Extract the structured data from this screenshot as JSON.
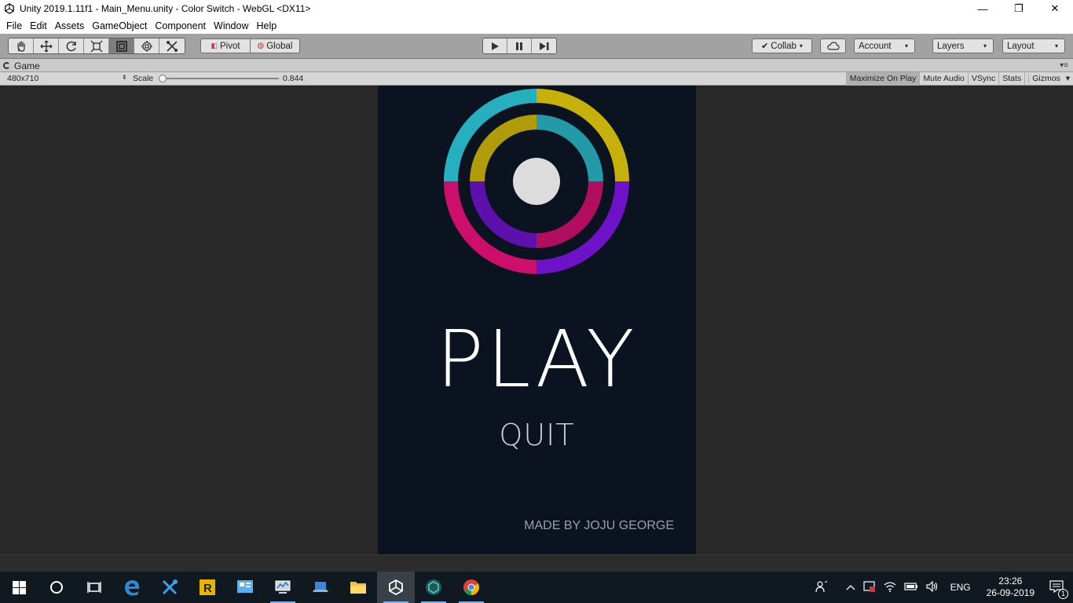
{
  "window": {
    "title": "Unity 2019.1.11f1 - Main_Menu.unity - Color Switch - WebGL <DX11>",
    "controls": [
      "—",
      "❐",
      "✕"
    ]
  },
  "menu": [
    "File",
    "Edit",
    "Assets",
    "GameObject",
    "Component",
    "Window",
    "Help"
  ],
  "toolbar": {
    "tools": [
      "hand-tool",
      "move-tool",
      "rotate-tool",
      "scale-tool",
      "rect-tool",
      "transform-tool",
      "custom-tool"
    ],
    "active_tool": "rect-tool",
    "pivot_label": "Pivot",
    "global_label": "Global",
    "collab_label": "Collab",
    "account_label": "Account",
    "layers_label": "Layers",
    "layout_label": "Layout"
  },
  "game_tab": {
    "label": "Game",
    "resolution": "480x710",
    "scale_label": "Scale",
    "scale_value": "0.844",
    "maximize_label": "Maximize On Play",
    "mute_label": "Mute Audio",
    "vsync_label": "VSync",
    "stats_label": "Stats",
    "gizmos_label": "Gizmos"
  },
  "game": {
    "play_label": "PLAY",
    "quit_label": "QUIT",
    "credit": "MADE BY JOJU GEORGE",
    "colors": {
      "background": "#0b1220",
      "cyan": "#27aebf",
      "yellow": "#c5b00c",
      "magenta": "#cc0f6b",
      "purple": "#6e12c8",
      "ball": "#dcdcdc"
    }
  },
  "taskbar": {
    "lang": "ENG",
    "time": "23:26",
    "date": "26-09-2019",
    "notification_count": "1"
  }
}
